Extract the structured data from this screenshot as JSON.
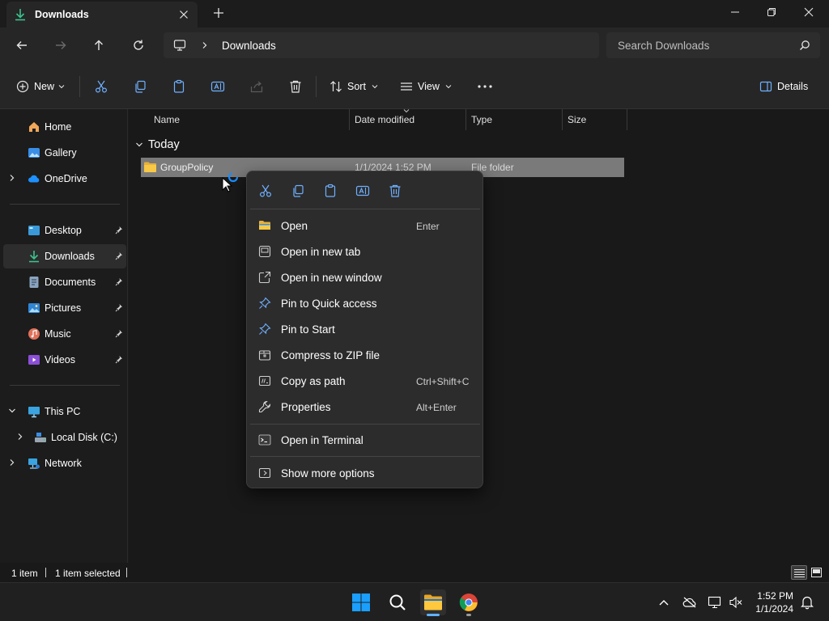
{
  "window": {
    "tab_title": "Downloads",
    "controls": [
      "minimize",
      "restore",
      "close"
    ]
  },
  "address": {
    "crumb": "Downloads",
    "search_placeholder": "Search Downloads"
  },
  "commandbar": {
    "new_label": "New",
    "sort_label": "Sort",
    "view_label": "View",
    "details_label": "Details"
  },
  "sidebar": {
    "items": [
      {
        "label": "Home",
        "icon": "home-icon"
      },
      {
        "label": "Gallery",
        "icon": "gallery-icon"
      },
      {
        "label": "OneDrive",
        "icon": "cloud-icon"
      },
      {
        "label": "Desktop",
        "icon": "desktop-icon"
      },
      {
        "label": "Downloads",
        "icon": "download-icon"
      },
      {
        "label": "Documents",
        "icon": "document-icon"
      },
      {
        "label": "Pictures",
        "icon": "pictures-icon"
      },
      {
        "label": "Music",
        "icon": "music-icon"
      },
      {
        "label": "Videos",
        "icon": "videos-icon"
      },
      {
        "label": "This PC",
        "icon": "pc-icon"
      },
      {
        "label": "Local Disk (C:)",
        "icon": "drive-icon"
      },
      {
        "label": "Network",
        "icon": "network-icon"
      }
    ]
  },
  "content": {
    "columns": [
      "Name",
      "Date modified",
      "Type",
      "Size"
    ],
    "group_label": "Today",
    "files": [
      {
        "name": "GroupPolicy",
        "date": "1/1/2024 1:52 PM",
        "type": "File folder",
        "size": ""
      }
    ]
  },
  "context_menu": {
    "top_actions": [
      "cut",
      "copy",
      "paste",
      "rename",
      "delete"
    ],
    "items": [
      {
        "label": "Open",
        "accel": "Enter",
        "icon": "folder-open-icon"
      },
      {
        "label": "Open in new tab",
        "accel": "",
        "icon": "new-tab-icon"
      },
      {
        "label": "Open in new window",
        "accel": "",
        "icon": "new-window-icon"
      },
      {
        "label": "Pin to Quick access",
        "accel": "",
        "icon": "pin-icon"
      },
      {
        "label": "Pin to Start",
        "accel": "",
        "icon": "pin-start-icon"
      },
      {
        "label": "Compress to ZIP file",
        "accel": "",
        "icon": "zip-icon"
      },
      {
        "label": "Copy as path",
        "accel": "Ctrl+Shift+C",
        "icon": "copy-path-icon"
      },
      {
        "label": "Properties",
        "accel": "Alt+Enter",
        "icon": "properties-icon"
      },
      {
        "label": "Open in Terminal",
        "accel": "",
        "icon": "terminal-icon"
      },
      {
        "label": "Show more options",
        "accel": "",
        "icon": "more-options-icon"
      }
    ]
  },
  "statusbar": {
    "item_count": "1 item",
    "selected": "1 item selected"
  },
  "taskbar": {
    "time": "1:52 PM",
    "date": "1/1/2024"
  },
  "colors": {
    "accent": "#0078d4",
    "folder": "#f8c946",
    "selection": "#7a7a7a",
    "menu_bg": "#2c2c2c"
  }
}
